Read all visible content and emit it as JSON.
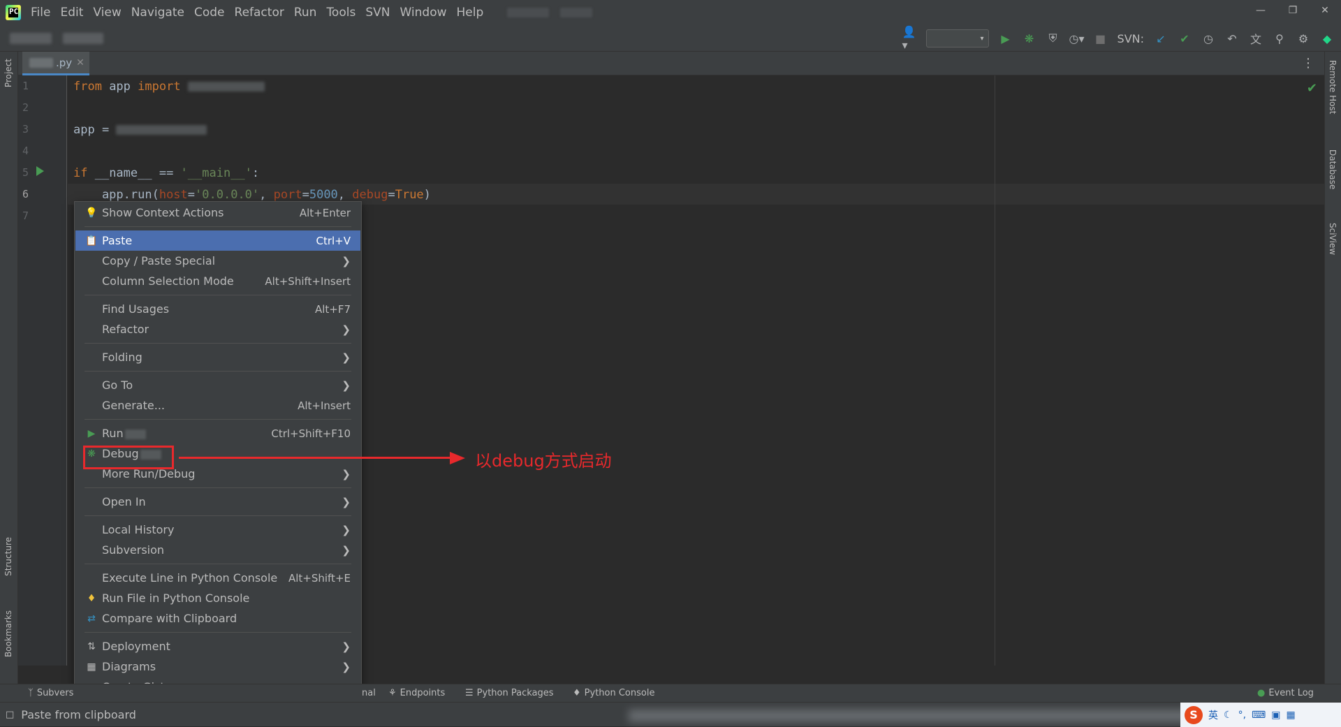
{
  "menubar": {
    "items": [
      "File",
      "Edit",
      "View",
      "Navigate",
      "Code",
      "Refactor",
      "Run",
      "Tools",
      "SVN",
      "Window",
      "Help"
    ]
  },
  "toolbar": {
    "svn_label": "SVN:"
  },
  "side_tabs": {
    "left_top": "Project",
    "left_structure": "Structure",
    "left_bookmarks": "Bookmarks",
    "right_remote": "Remote Host",
    "right_database": "Database",
    "right_sciview": "SciView"
  },
  "editor_tab": {
    "name_suffix": ".py"
  },
  "code": {
    "line_numbers": [
      "1",
      "2",
      "3",
      "4",
      "5",
      "6",
      "7"
    ],
    "line1_from": "from",
    "line1_mod": " app ",
    "line1_import": "import",
    "line3": "app = ",
    "line5_if": "if",
    "line5_name": " __name__ == ",
    "line5_str": "'__main__'",
    "line5_colon": ":",
    "line6_pre": "    app.run(",
    "line6_host": "host",
    "line6_eq1": "=",
    "line6_hostval": "'0.0.0.0'",
    "line6_comma1": ", ",
    "line6_port": "port",
    "line6_eq2": "=",
    "line6_portval": "5000",
    "line6_comma2": ", ",
    "line6_debug": "debug",
    "line6_eq3": "=",
    "line6_debugval": "True",
    "line6_close": ")"
  },
  "context_menu": {
    "items": [
      {
        "label": "Show Context Actions",
        "shortcut": "Alt+Enter"
      },
      {
        "label": "Paste",
        "shortcut": "Ctrl+V"
      },
      {
        "label": "Copy / Paste Special"
      },
      {
        "label": "Column Selection Mode",
        "shortcut": "Alt+Shift+Insert"
      },
      {
        "label": "Find Usages",
        "shortcut": "Alt+F7"
      },
      {
        "label": "Refactor"
      },
      {
        "label": "Folding"
      },
      {
        "label": "Go To"
      },
      {
        "label": "Generate...",
        "shortcut": "Alt+Insert"
      },
      {
        "label": "Run",
        "shortcut": "Ctrl+Shift+F10"
      },
      {
        "label": "Debug"
      },
      {
        "label": "More Run/Debug"
      },
      {
        "label": "Open In"
      },
      {
        "label": "Local History"
      },
      {
        "label": "Subversion"
      },
      {
        "label": "Execute Line in Python Console",
        "shortcut": "Alt+Shift+E"
      },
      {
        "label": "Run File in Python Console"
      },
      {
        "label": "Compare with Clipboard"
      },
      {
        "label": "Deployment"
      },
      {
        "label": "Diagrams"
      },
      {
        "label": "Create Gist..."
      }
    ]
  },
  "annotation": {
    "text": "以debug方式启动",
    "color": "#e8292c"
  },
  "bottom_bar": {
    "subversion": "Subvers",
    "terminal": "nal",
    "endpoints": "Endpoints",
    "python_packages": "Python Packages",
    "python_console": "Python Console",
    "event_log": "Event Log"
  },
  "status_bar": {
    "message": "Paste from clipboard",
    "ime_label": "英"
  },
  "colors": {
    "selection": "#4b6eaf",
    "run_green": "#499c54",
    "keyword": "#cc7832",
    "string": "#6a8759",
    "number": "#6897bb"
  }
}
